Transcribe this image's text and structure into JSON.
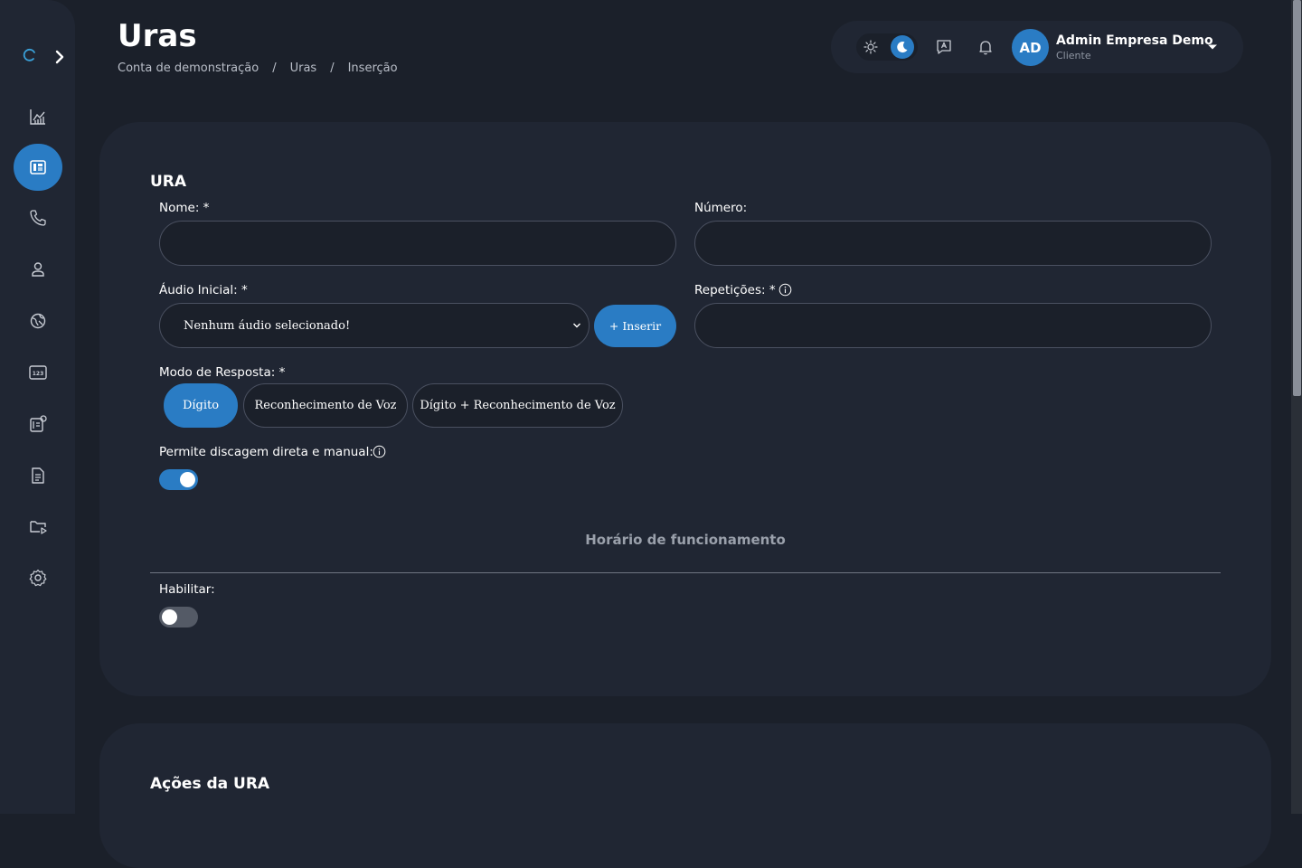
{
  "header": {
    "title": "Uras",
    "breadcrumb": [
      "Conta de demonstração",
      "Uras",
      "Inserção"
    ],
    "breadcrumb_separator": "/"
  },
  "user": {
    "initials": "AD",
    "name": "Admin Empresa Demo",
    "role": "Cliente"
  },
  "theme": {
    "mode": "dark",
    "accent": "#2a7cc4"
  },
  "sidebar": {
    "items": [
      {
        "icon": "chart-icon",
        "active": false
      },
      {
        "icon": "ura-icon",
        "active": true
      },
      {
        "icon": "phone-icon",
        "active": false
      },
      {
        "icon": "user-icon",
        "active": false
      },
      {
        "icon": "globe-icon",
        "active": false
      },
      {
        "icon": "numbers-icon",
        "active": false
      },
      {
        "icon": "queue-icon",
        "active": false
      },
      {
        "icon": "document-icon",
        "active": false
      },
      {
        "icon": "media-folder-icon",
        "active": false
      },
      {
        "icon": "settings-icon",
        "active": false
      }
    ]
  },
  "form": {
    "section_title": "URA",
    "name_label": "Nome: *",
    "name_value": "",
    "number_label": "Número:",
    "number_value": "",
    "audio_label": "Áudio Inicial: *",
    "audio_selected": "Nenhum áudio selecionado!",
    "insert_button": "+ Inserir",
    "repetitions_label": "Repetições: *",
    "repetitions_value": "",
    "mode_label": "Modo de Resposta: *",
    "modes": [
      "Dígito",
      "Reconhecimento de Voz",
      "Dígito + Reconhecimento de Voz"
    ],
    "mode_selected": "Dígito",
    "direct_dial_label": "Permite discagem direta e manual:",
    "direct_dial_enabled": true,
    "hours_title": "Horário de funcionamento",
    "enable_label": "Habilitar:",
    "enable_enabled": false
  },
  "actions": {
    "section_title": "Ações da URA"
  }
}
